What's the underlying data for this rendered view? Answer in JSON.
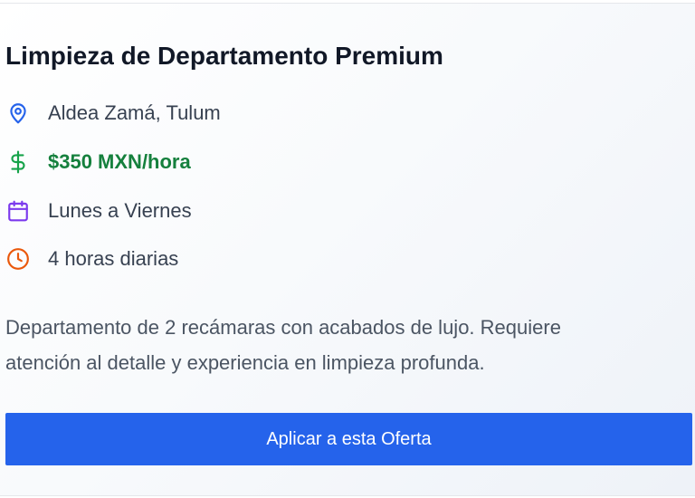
{
  "job": {
    "title": "Limpieza de Departamento Premium",
    "location": "Aldea Zamá, Tulum",
    "price": "$350 MXN/hora",
    "days": "Lunes a Viernes",
    "hours": "4 horas diarias",
    "description": "Departamento de 2 recámaras con acabados de lujo. Requiere atención al detalle y experiencia en limpieza profunda.",
    "apply_label": "Aplicar a esta Oferta"
  },
  "icons": {
    "location": "map-pin-icon",
    "price": "dollar-sign-icon",
    "days": "calendar-icon",
    "hours": "clock-icon"
  },
  "colors": {
    "location_icon": "#2563eb",
    "price_icon": "#16a34a",
    "price_text": "#15803d",
    "calendar_icon": "#7c3aed",
    "clock_icon": "#ea580c",
    "button_bg": "#2563eb",
    "button_text": "#ffffff",
    "title": "#111827",
    "body_text": "#374151"
  }
}
